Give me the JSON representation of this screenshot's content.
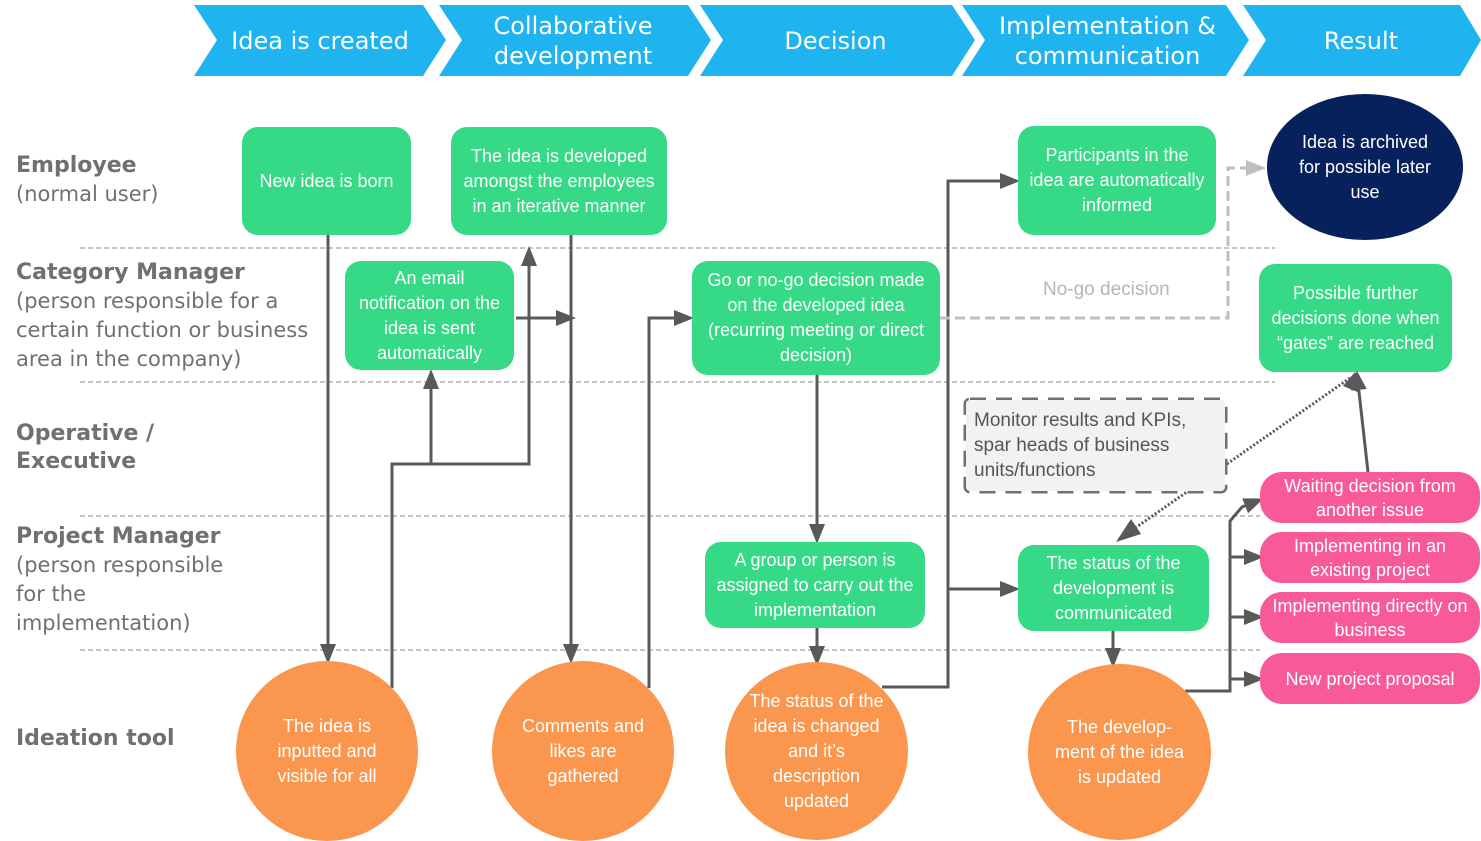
{
  "phases": [
    {
      "label": "Idea is created"
    },
    {
      "label": "Collaborative development"
    },
    {
      "label": "Decision"
    },
    {
      "label": "Implementation & communication"
    },
    {
      "label": "Result"
    }
  ],
  "lanes": [
    {
      "title": "Employee",
      "subtitle": "(normal user)"
    },
    {
      "title": "Category Manager",
      "subtitle": "(person responsible for a certain function or business area in the company)"
    },
    {
      "title": "Operative / Executive",
      "subtitle": ""
    },
    {
      "title": "Project Manager",
      "subtitle": "(person responsible for the implementation)"
    },
    {
      "title": "Ideation tool",
      "subtitle": ""
    }
  ],
  "nodes": {
    "new_idea": "New idea is born",
    "developed": "The idea is developed amongst the employees in an iterative manner",
    "email": "An email notification on the idea is sent automatically",
    "go_nogo": "Go or no-go decision made on the developed idea (recurring meeting or direct decision)",
    "participants": "Participants in the idea are automatically informed",
    "archived": "Idea is archived for possible later use",
    "further": "Possible further decisions done when “gates” are reached",
    "monitor": "Monitor results and KPIs, spar heads of business units/functions",
    "assigned": "A group or person is assigned to carry out the implementation",
    "status_comm": "The status of the development is communicated",
    "inputted": "The idea is inputted and visible for all",
    "comments": "Comments and likes are gathered",
    "status_changed": "The status of the idea is changed and it’s description updated",
    "dev_updated": "The develop-ment of the idea is updated"
  },
  "outcomes": [
    "Waiting decision from another issue",
    "Implementing in an existing project",
    "Implementing directly on business",
    "New project proposal"
  ],
  "labels": {
    "nogo": "No-go decision"
  },
  "colors": {
    "phase": "#1fb3f0",
    "action": "#36d986",
    "tool": "#fa964e",
    "outcome": "#f75999",
    "archive": "#06215b",
    "connector": "#595959"
  }
}
